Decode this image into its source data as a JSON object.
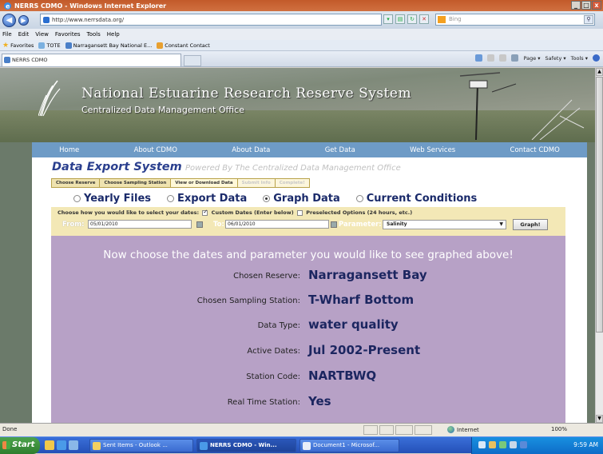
{
  "window": {
    "title": "NERRS CDMO - Windows Internet Explorer",
    "minimize": "_",
    "maximize": "□",
    "close": "x"
  },
  "browser": {
    "address": "http://www.nerrsdata.org/",
    "search_placeholder": "Bing",
    "menu": [
      "File",
      "Edit",
      "View",
      "Favorites",
      "Tools",
      "Help"
    ],
    "favorites_label": "Favorites",
    "favorites": [
      "TOTE",
      "Narragansett Bay National E...",
      "Constant Contact"
    ],
    "tab_title": "NERRS CDMO",
    "commands": [
      "Page ▾",
      "Safety ▾",
      "Tools ▾"
    ]
  },
  "site": {
    "title": "National Estuarine Research Reserve System",
    "subtitle": "Centralized Data Management Office",
    "nav": [
      "Home",
      "About CDMO",
      "About Data",
      "Get Data",
      "Web Services",
      "Contact CDMO"
    ]
  },
  "export": {
    "title": "Data Export System",
    "powered_by": "Powered By The Centralized Data Management Office",
    "steps": [
      {
        "label": "Choose Reserve",
        "state": "done"
      },
      {
        "label": "Choose Sampling Station",
        "state": "done"
      },
      {
        "label": "View or Download Data",
        "state": "active"
      },
      {
        "label": "Submit Info",
        "state": "disabled"
      },
      {
        "label": "Complete!",
        "state": "disabled"
      }
    ],
    "modes": [
      {
        "label": "Yearly Files",
        "selected": false
      },
      {
        "label": "Export Data",
        "selected": false
      },
      {
        "label": "Graph Data",
        "selected": true
      },
      {
        "label": "Current Conditions",
        "selected": false
      }
    ],
    "date_question": "Choose how you would like to select your dates:",
    "custom_dates": "Custom Dates (Enter below)",
    "custom_checked": true,
    "preselected": "Preselected Options (24 hours, etc.)",
    "preselected_checked": false,
    "from_label": "From:",
    "from_value": "05/01/2010",
    "to_label": "To:",
    "to_value": "06/01/2010",
    "parameter_label": "Parameter:",
    "parameter_value": "Salinity",
    "graph_button": "Graph!",
    "prompt": "Now choose the dates and parameter you would like to see graphed above!",
    "info": [
      {
        "label": "Chosen Reserve:",
        "value": "Narragansett Bay"
      },
      {
        "label": "Chosen Sampling Station:",
        "value": "T-Wharf Bottom"
      },
      {
        "label": "Data Type:",
        "value": "water quality"
      },
      {
        "label": "Active Dates:",
        "value": "Jul 2002-Present"
      },
      {
        "label": "Station Code:",
        "value": "NARTBWQ"
      },
      {
        "label": "Real Time Station:",
        "value": "Yes"
      }
    ]
  },
  "status": {
    "text": "Done",
    "zone": "Internet",
    "zoom": "100%"
  },
  "taskbar": {
    "start": "Start",
    "items": [
      {
        "label": "Sent Items - Outlook ...",
        "active": false
      },
      {
        "label": "NERRS CDMO - Win...",
        "active": true
      },
      {
        "label": "Document1 - Microsof...",
        "active": false
      }
    ],
    "clock": "9:59 AM"
  },
  "colors": {
    "nav_bar": "#6e9bc6",
    "export_title": "#2a3f8e",
    "panel_purple": "#b7a1c6",
    "date_bar": "#f3e8b6",
    "title_bar": "#c25a2a"
  }
}
